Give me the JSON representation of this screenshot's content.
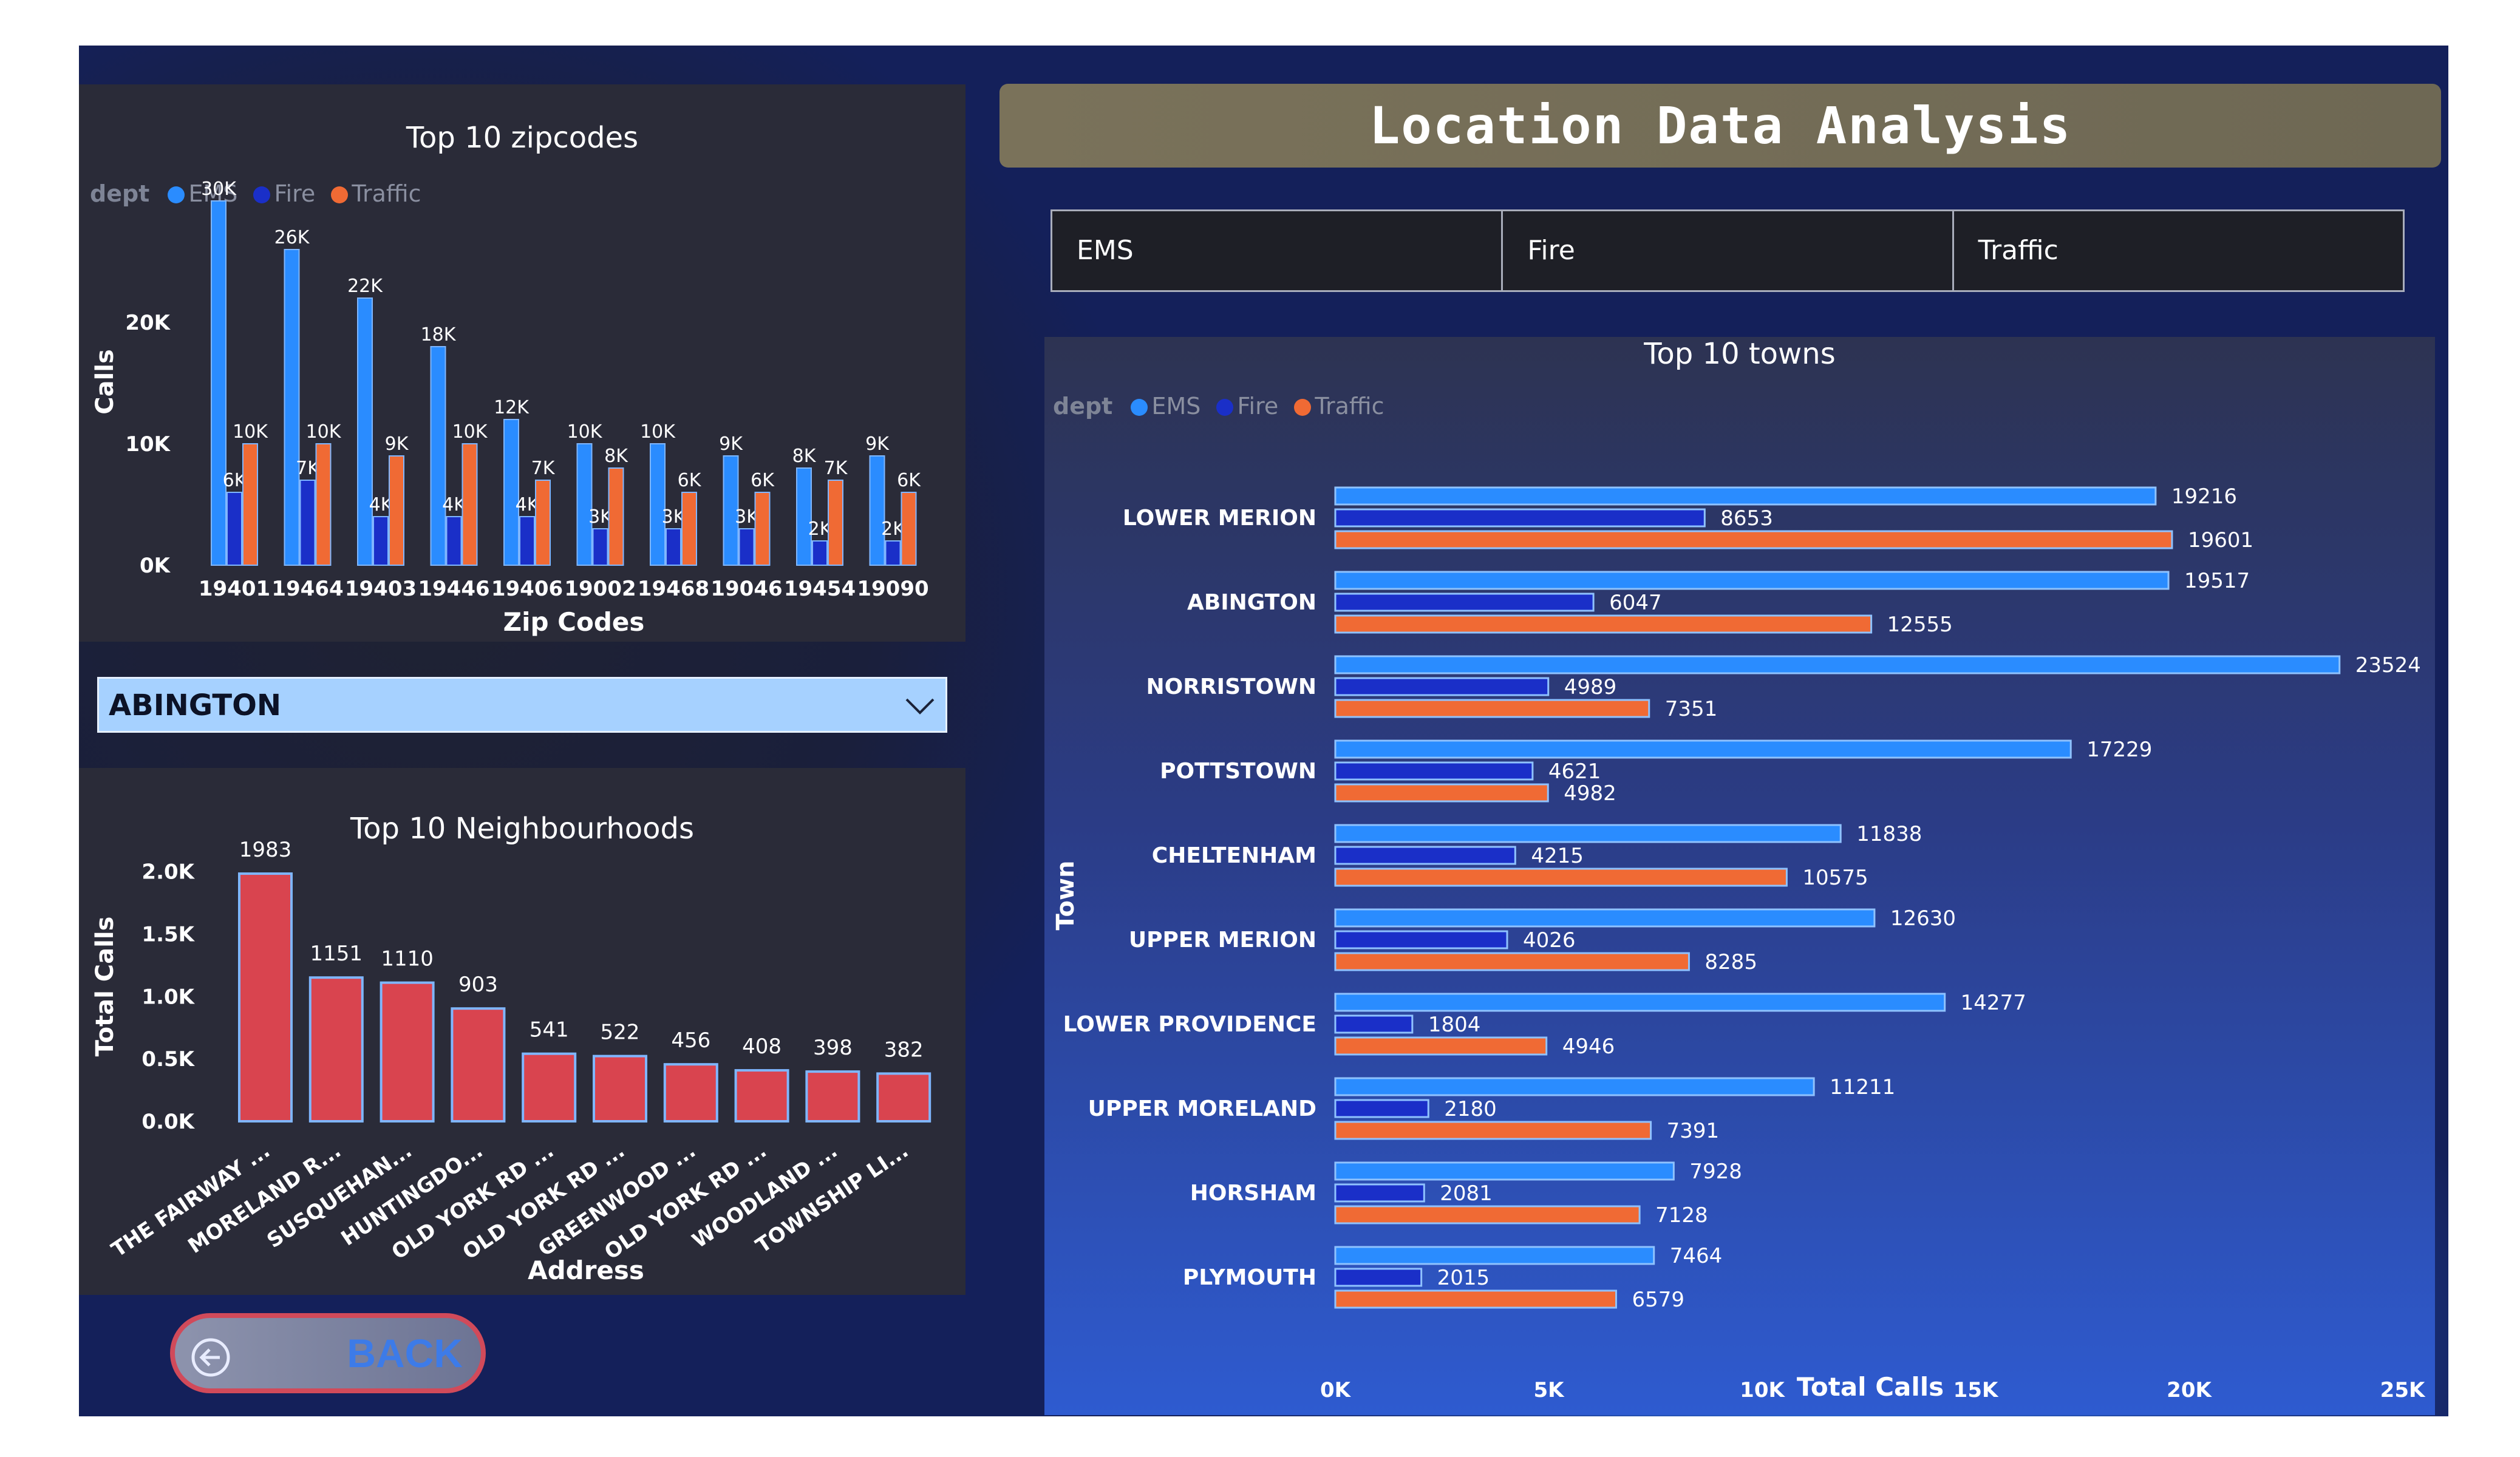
{
  "colors": {
    "ems": "#2a8cff",
    "fire": "#1a2fc8",
    "traffic": "#f06a34",
    "neighbourhood": "#d9444f"
  },
  "title": "Location Data Analysis",
  "dept_buttons": [
    "EMS",
    "Fire",
    "Traffic"
  ],
  "town_select": {
    "value": "ABINGTON"
  },
  "back_button": {
    "label": "BACK"
  },
  "zip_chart": {
    "type": "bar",
    "title": "Top 10 zipcodes",
    "legend_title": "dept",
    "xlabel": "Zip Codes",
    "ylabel": "Calls",
    "ylim": [
      0,
      30000
    ],
    "yticks": [
      "0K",
      "10K",
      "20K"
    ],
    "categories": [
      "19401",
      "19464",
      "19403",
      "19446",
      "19406",
      "19002",
      "19468",
      "19046",
      "19454",
      "19090"
    ],
    "series": [
      {
        "name": "EMS",
        "values": [
          30000,
          26000,
          22000,
          18000,
          12000,
          10000,
          10000,
          9000,
          8000,
          9000
        ],
        "labels": [
          "30K",
          "26K",
          "22K",
          "18K",
          "12K",
          "10K",
          "10K",
          "9K",
          "8K",
          "9K"
        ]
      },
      {
        "name": "Fire",
        "values": [
          6000,
          7000,
          4000,
          4000,
          4000,
          3000,
          3000,
          3000,
          2000,
          2000
        ],
        "labels": [
          "6K",
          "7K",
          "4K",
          "4K",
          "4K",
          "3K",
          "3K",
          "3K",
          "2K",
          "2K"
        ]
      },
      {
        "name": "Traffic",
        "values": [
          10000,
          10000,
          9000,
          10000,
          7000,
          8000,
          6000,
          6000,
          7000,
          6000
        ],
        "labels": [
          "10K",
          "10K",
          "9K",
          "10K",
          "7K",
          "8K",
          "6K",
          "6K",
          "7K",
          "6K"
        ]
      }
    ]
  },
  "neighbourhood_chart": {
    "type": "bar",
    "title": "Top 10 Neighbourhoods",
    "xlabel": "Address",
    "ylabel": "Total Calls",
    "ylim": [
      0,
      2000
    ],
    "yticks": [
      "0.0K",
      "0.5K",
      "1.0K",
      "1.5K",
      "2.0K"
    ],
    "categories": [
      "THE FAIRWAY ...",
      "MORELAND R...",
      "SUSQUEHAN...",
      "HUNTINGDO...",
      "OLD YORK RD ...",
      "OLD YORK RD ...",
      "GREENWOOD ...",
      "OLD YORK RD ...",
      "WOODLAND ...",
      "TOWNSHIP LI..."
    ],
    "values": [
      1983,
      1151,
      1110,
      903,
      541,
      522,
      456,
      408,
      398,
      382
    ]
  },
  "towns_chart": {
    "type": "bar",
    "title": "Top 10 towns",
    "legend_title": "dept",
    "xlabel": "Total Calls",
    "ylabel": "Town",
    "xlim": [
      0,
      25000
    ],
    "xticks": [
      "0K",
      "5K",
      "10K",
      "15K",
      "20K",
      "25K"
    ],
    "categories": [
      "LOWER MERION",
      "ABINGTON",
      "NORRISTOWN",
      "POTTSTOWN",
      "CHELTENHAM",
      "UPPER MERION",
      "LOWER PROVIDENCE",
      "UPPER MORELAND",
      "HORSHAM",
      "PLYMOUTH"
    ],
    "series": [
      {
        "name": "EMS",
        "values": [
          19216,
          19517,
          23524,
          17229,
          11838,
          12630,
          14277,
          11211,
          7928,
          7464
        ]
      },
      {
        "name": "Fire",
        "values": [
          8653,
          6047,
          4989,
          4621,
          4215,
          4026,
          1804,
          2180,
          2081,
          2015
        ]
      },
      {
        "name": "Traffic",
        "values": [
          19601,
          12555,
          7351,
          4982,
          10575,
          8285,
          4946,
          7391,
          7128,
          6579
        ]
      }
    ]
  }
}
